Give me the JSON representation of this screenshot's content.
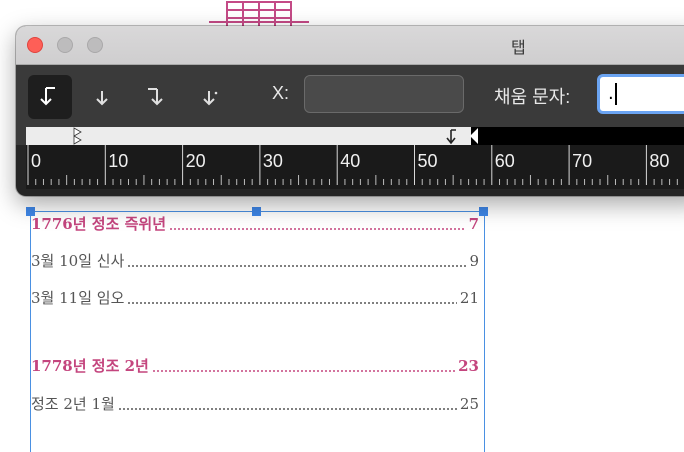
{
  "palette": {
    "title": "탭",
    "x_label": "X:",
    "x_value": "",
    "fill_label": "채움 문자:",
    "fill_value": ".",
    "tab_buttons": [
      {
        "icon": "left-justified-tab-icon",
        "active": true
      },
      {
        "icon": "center-justified-tab-icon",
        "active": false
      },
      {
        "icon": "right-justified-tab-icon",
        "active": false
      },
      {
        "icon": "align-on-decimal-tab-icon",
        "active": false
      }
    ],
    "ruler_labels": [
      "0",
      "10",
      "20",
      "30",
      "40",
      "50",
      "60",
      "70",
      "80"
    ]
  },
  "toc": [
    {
      "title": "1776년 정조 즉위년",
      "page": "7",
      "heading": true
    },
    {
      "title": "3월 10일 신사",
      "page": "9",
      "heading": false
    },
    {
      "title": "3월 11일 임오",
      "page": "21",
      "heading": false
    },
    {
      "title": "1778년 정조 2년",
      "page": "23",
      "heading": true
    },
    {
      "title": "정조 2년 1월",
      "page": "25",
      "heading": false
    }
  ]
}
